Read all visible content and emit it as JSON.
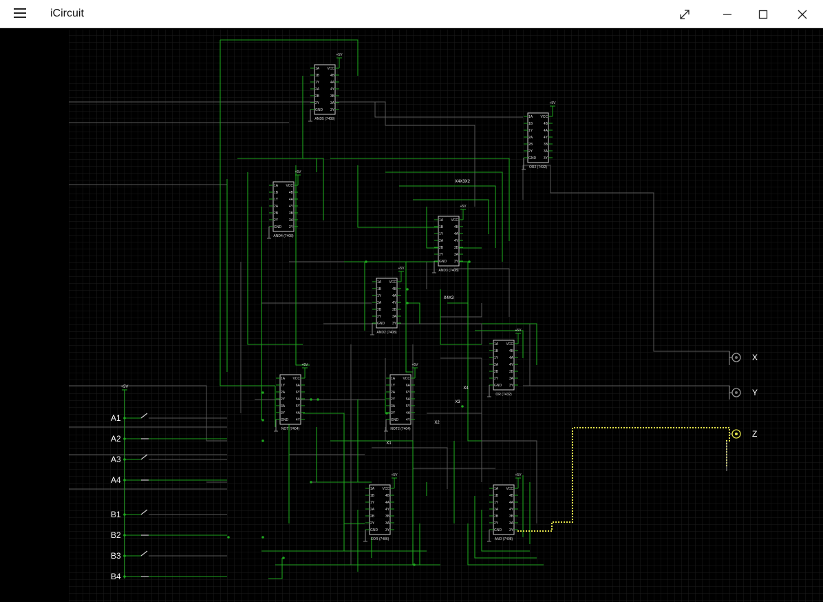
{
  "window": {
    "title": "iCircuit",
    "menu_icon": "hamburger-menu-icon",
    "fullscreen_icon": "expand-diagonal-icon",
    "minimize_icon": "minimize-icon",
    "maximize_icon": "maximize-icon",
    "close_icon": "close-icon"
  },
  "colors": {
    "background": "#000000",
    "grid": "#1f1f1f",
    "wire": "#1ea51e",
    "wire_dim": "#5a5a5a",
    "chip_fill": "#ffffff",
    "chip_text": "#000000",
    "label_text": "#ffffff",
    "active_wire": "#e6e64a"
  },
  "chips": [
    {
      "id": "and5",
      "name": "AND5 (7408)",
      "left_pins": [
        "1A",
        "1B",
        "1Y",
        "2A",
        "2B",
        "2Y",
        "GND"
      ],
      "right_pins": [
        "VCC",
        "4B",
        "4A",
        "4Y",
        "3B",
        "3A",
        "3Y"
      ],
      "power": "+5V"
    },
    {
      "id": "or2",
      "name": "OR2 (7432)",
      "left_pins": [
        "1A",
        "1B",
        "1Y",
        "2A",
        "2B",
        "2Y",
        "GND"
      ],
      "right_pins": [
        "VCC",
        "4B",
        "4A",
        "4Y",
        "3B",
        "3A",
        "3Y"
      ],
      "power": "+5V"
    },
    {
      "id": "and4",
      "name": "AND4 (7408)",
      "left_pins": [
        "1A",
        "1B",
        "1Y",
        "2A",
        "2B",
        "2Y",
        "GND"
      ],
      "right_pins": [
        "VCC",
        "4B",
        "4A",
        "4Y",
        "3B",
        "3A",
        "3Y"
      ],
      "power": "+5V"
    },
    {
      "id": "and3",
      "name": "AND3 (7408)",
      "left_pins": [
        "1A",
        "1B",
        "1Y",
        "2A",
        "2B",
        "2Y",
        "GND"
      ],
      "right_pins": [
        "VCC",
        "4B",
        "4A",
        "4Y",
        "3B",
        "3A",
        "3Y"
      ],
      "power": "+5V"
    },
    {
      "id": "and2",
      "name": "AND2 (7408)",
      "left_pins": [
        "1A",
        "1B",
        "1Y",
        "2A",
        "2B",
        "2Y",
        "GND"
      ],
      "right_pins": [
        "VCC",
        "4B",
        "4A",
        "4Y",
        "3B",
        "3A",
        "3Y"
      ],
      "power": "+5V"
    },
    {
      "id": "or",
      "name": "OR (7432)",
      "left_pins": [
        "1A",
        "1B",
        "1Y",
        "2A",
        "2B",
        "2Y",
        "GND"
      ],
      "right_pins": [
        "VCC",
        "4B",
        "4A",
        "4Y",
        "3B",
        "3A",
        "3Y"
      ],
      "power": "+5V"
    },
    {
      "id": "not",
      "name": "NOT (7404)",
      "left_pins": [
        "1A",
        "1Y",
        "2A",
        "2Y",
        "3A",
        "3Y",
        "GND"
      ],
      "right_pins": [
        "VCC",
        "6A",
        "6Y",
        "5A",
        "5Y",
        "4A",
        "4Y"
      ],
      "power": "+5V"
    },
    {
      "id": "not2",
      "name": "NOT2 (7404)",
      "left_pins": [
        "1A",
        "1Y",
        "2A",
        "2Y",
        "3A",
        "3Y",
        "GND"
      ],
      "right_pins": [
        "VCC",
        "6A",
        "6Y",
        "5A",
        "5Y",
        "4A",
        "4Y"
      ],
      "power": "+5V"
    },
    {
      "id": "xor",
      "name": "XOR (7486)",
      "left_pins": [
        "1A",
        "1B",
        "1Y",
        "2A",
        "2B",
        "2Y",
        "GND"
      ],
      "right_pins": [
        "VCC",
        "4B",
        "4A",
        "4Y",
        "3B",
        "3A",
        "3Y"
      ],
      "power": "+5V"
    },
    {
      "id": "and",
      "name": "AND (7408)",
      "left_pins": [
        "1A",
        "1B",
        "1Y",
        "2A",
        "2B",
        "2Y",
        "GND"
      ],
      "right_pins": [
        "VCC",
        "4B",
        "4A",
        "4Y",
        "3B",
        "3A",
        "3Y"
      ],
      "power": "+5V"
    }
  ],
  "net_labels": [
    "X4X3X2",
    "X4X3",
    "X4",
    "X3",
    "X2",
    "X1"
  ],
  "inputs": {
    "power": "+5V",
    "switches": [
      {
        "label": "A1",
        "state": "open"
      },
      {
        "label": "A2",
        "state": "closed"
      },
      {
        "label": "A3",
        "state": "open"
      },
      {
        "label": "A4",
        "state": "closed"
      },
      {
        "label": "B1",
        "state": "open"
      },
      {
        "label": "B2",
        "state": "closed"
      },
      {
        "label": "B3",
        "state": "open"
      },
      {
        "label": "B4",
        "state": "closed"
      }
    ]
  },
  "outputs": [
    {
      "label": "X",
      "active": false
    },
    {
      "label": "Y",
      "active": false
    },
    {
      "label": "Z",
      "active": true
    }
  ]
}
